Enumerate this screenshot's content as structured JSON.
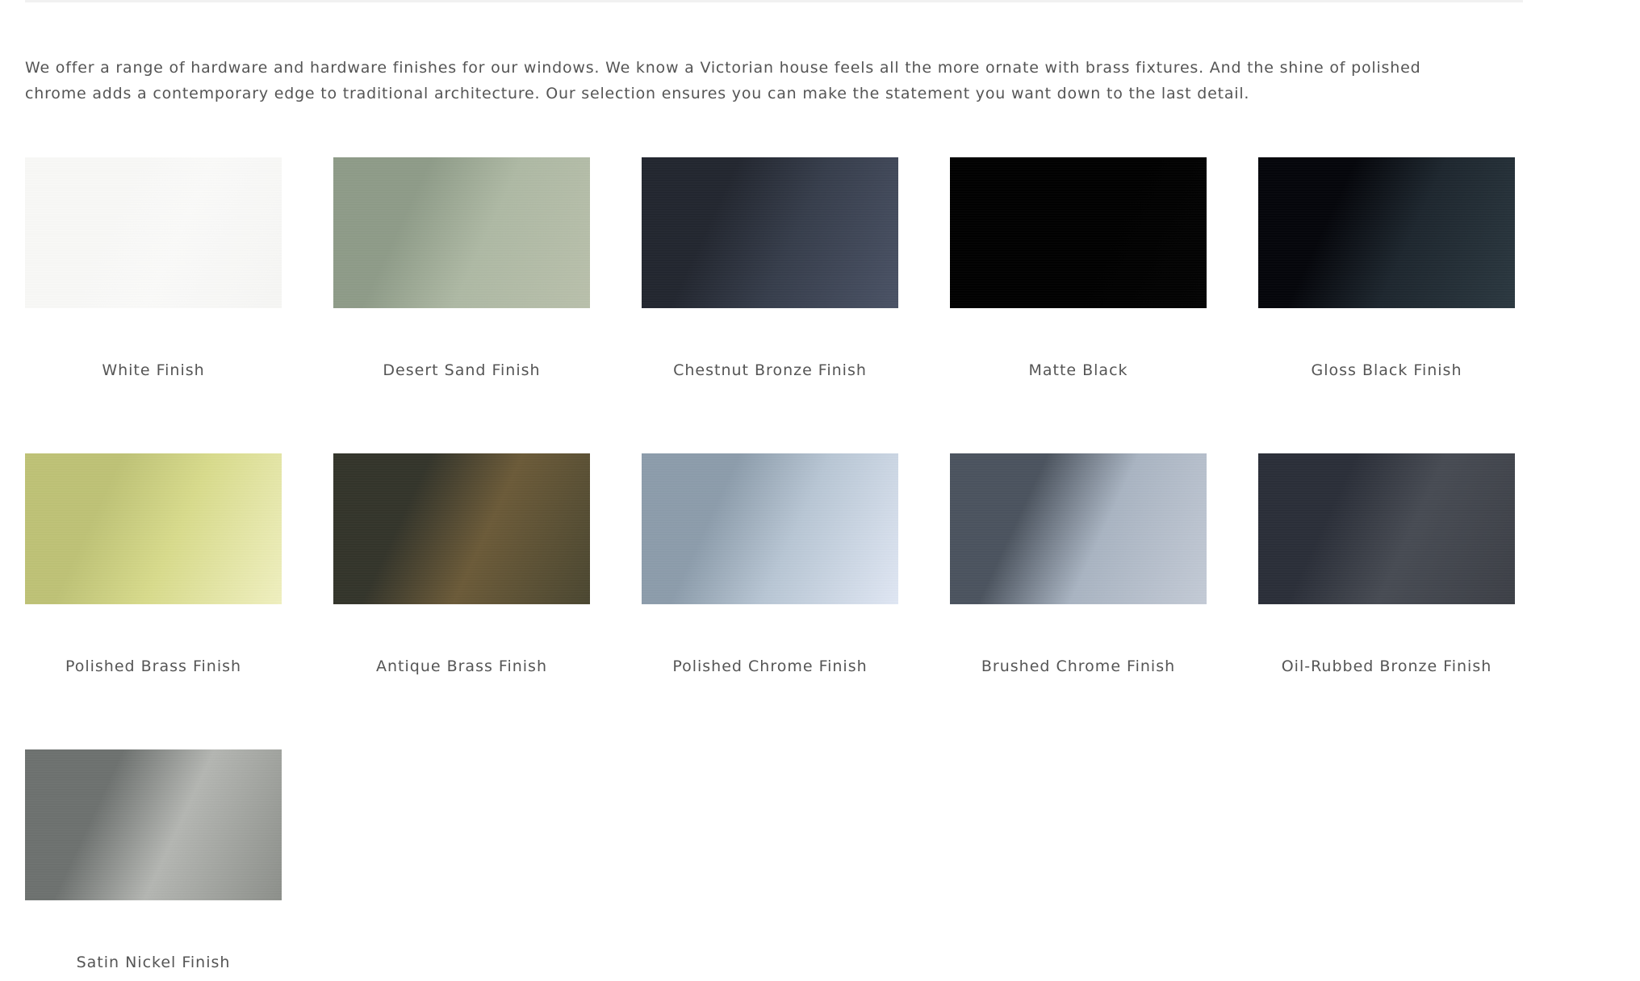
{
  "intro": {
    "text": "We offer a range of hardware and hardware finishes for our windows. We know a Victorian house feels all the more ornate with brass fixtures. And the shine of polished chrome adds a contemporary edge to traditional architecture. Our selection ensures you can make the statement you want down to the last detail."
  },
  "finishes": [
    {
      "name": "White Finish",
      "icon": "white-finish-swatch",
      "colors": [
        "#f8f8f6",
        "#fafaf9",
        "#f6f6f4"
      ]
    },
    {
      "name": "Desert Sand Finish",
      "icon": "desert-sand-finish-swatch",
      "colors": [
        "#8e9b88",
        "#aeb9a4",
        "#b9c0ab"
      ]
    },
    {
      "name": "Chestnut Bronze Finish",
      "icon": "chestnut-bronze-finish-swatch",
      "colors": [
        "#22262f",
        "#363d4b",
        "#4a5265"
      ]
    },
    {
      "name": "Matte Black",
      "icon": "matte-black-swatch",
      "colors": [
        "#000000",
        "#000000",
        "#030303"
      ]
    },
    {
      "name": "Gloss Black Finish",
      "icon": "gloss-black-finish-swatch",
      "colors": [
        "#04050a",
        "#1d262e",
        "#2b3840"
      ]
    },
    {
      "name": "Polished Brass Finish",
      "icon": "polished-brass-finish-swatch",
      "colors": [
        "#bec276",
        "#d8db8c",
        "#f0f0c0"
      ]
    },
    {
      "name": "Antique Brass Finish",
      "icon": "antique-brass-finish-swatch",
      "colors": [
        "#33342a",
        "#6b5a38",
        "#4a4630"
      ]
    },
    {
      "name": "Polished Chrome Finish",
      "icon": "polished-chrome-finish-swatch",
      "colors": [
        "#8c9cab",
        "#b8c6d4",
        "#e0e7f4"
      ]
    },
    {
      "name": "Brushed Chrome Finish",
      "icon": "brushed-chrome-finish-swatch",
      "colors": [
        "#4b535e",
        "#a9b4c2",
        "#c4cbd6"
      ]
    },
    {
      "name": "Oil-Rubbed Bronze Finish",
      "icon": "oil-rubbed-bronze-finish-swatch",
      "colors": [
        "#2a2e38",
        "#474b53",
        "#3c3f46"
      ]
    },
    {
      "name": "Satin Nickel Finish",
      "icon": "satin-nickel-finish-swatch",
      "colors": [
        "#6d716f",
        "#b4b6b2",
        "#8c8f8a"
      ]
    }
  ]
}
